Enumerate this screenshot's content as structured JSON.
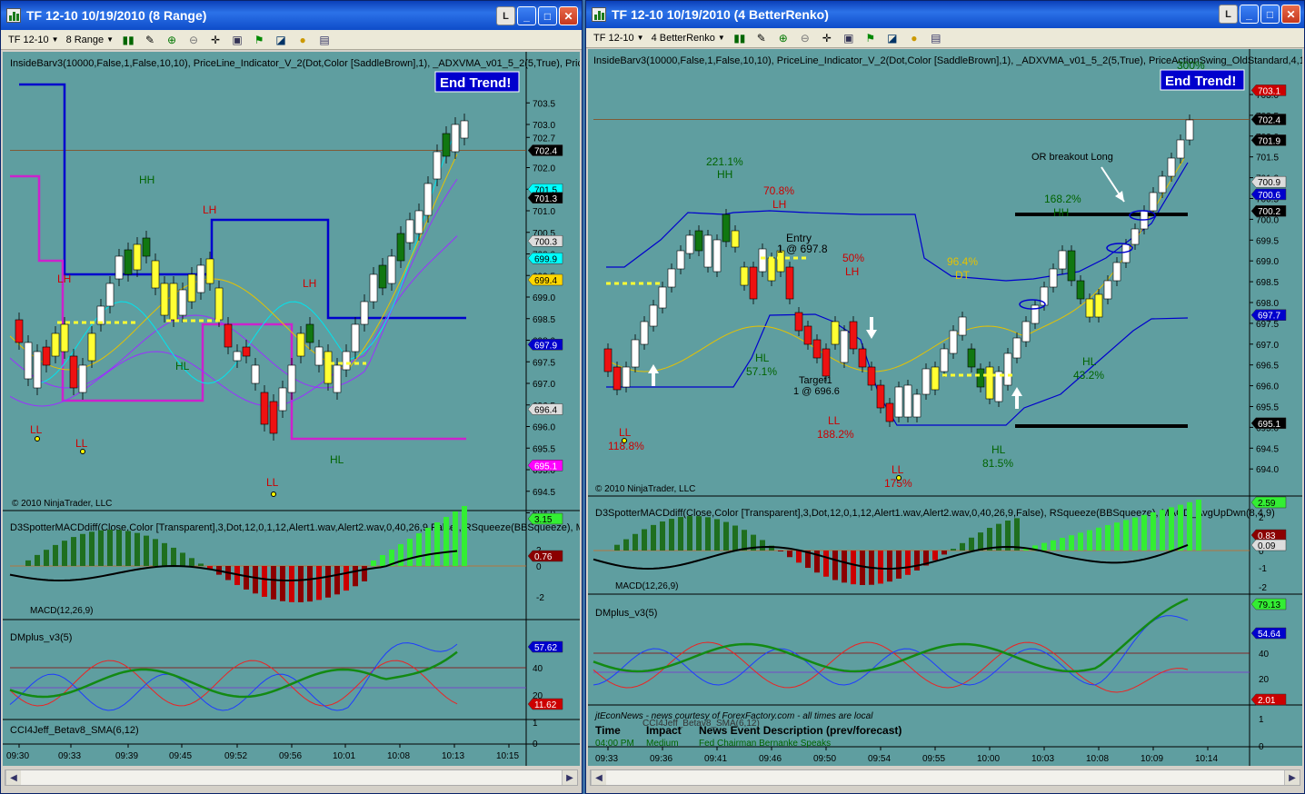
{
  "left_window": {
    "title": "TF 12-10  10/19/2010 (8 Range)",
    "btn_l": "L",
    "instrument": "TF 12-10",
    "period": "8 Range",
    "indicator_line": "InsideBarv3(10000,False,1,False,10,10), PriceLine_Indicator_V_2(Dot,Color [SaddleBrown],1), _ADXVMA_v01_5_2(5,True), Pric",
    "end_trend": "End Trend!",
    "copyright": "© 2010 NinjaTrader, LLC",
    "price_ticks": [
      "703.5",
      "703.0",
      "702.7",
      "702.0",
      "701.5",
      "701.0",
      "700.5",
      "700.0",
      "699.5",
      "699.0",
      "698.5",
      "698.0",
      "697.5",
      "697.0",
      "696.5",
      "696.0",
      "695.5",
      "695.0",
      "694.5",
      "694.0"
    ],
    "price_tags": [
      {
        "v": "702.4",
        "c": "#000000",
        "t": "#ffffff"
      },
      {
        "v": "701.5",
        "c": "#00ffff",
        "t": "#000000"
      },
      {
        "v": "701.3",
        "c": "#000000",
        "t": "#ffffff"
      },
      {
        "v": "700.3",
        "c": "#dddddd",
        "t": "#000000"
      },
      {
        "v": "699.9",
        "c": "#00ffff",
        "t": "#000000"
      },
      {
        "v": "699.4",
        "c": "#ffd700",
        "t": "#000000"
      },
      {
        "v": "697.9",
        "c": "#0000cd",
        "t": "#ffffff"
      },
      {
        "v": "696.4",
        "c": "#dddddd",
        "t": "#000000"
      },
      {
        "v": "695.1",
        "c": "#ff00ff",
        "t": "#ffffff"
      }
    ],
    "labels": {
      "hh": "HH",
      "lh1": "LH",
      "lh2": "LH",
      "lh3": "LH",
      "hl1": "HL",
      "hl2": "HL",
      "ll1": "LL",
      "ll2": "LL",
      "ll3": "LL"
    },
    "macd_panel": "D3SpotterMACDdiff(Close,Color [Transparent],3,Dot,12,0,1,12,Alert1.wav,Alert2.wav,0,40,26,9,False), RSqueeze(BBSqueeze), M",
    "macd_label": "MACD(12,26,9)",
    "macd_ticks": [
      "2",
      "0",
      "-2"
    ],
    "macd_tags": [
      "3.15",
      "0.76"
    ],
    "dm_panel": "DMplus_v3(5)",
    "dm_ticks": [
      "40",
      "20"
    ],
    "dm_tags": [
      "57.62",
      "11.62"
    ],
    "cci_panel": "CCI4Jeff_Betav8_SMA(6,12)",
    "cci_ticks": [
      "1",
      "0"
    ],
    "time_ticks": [
      "09:30",
      "09:33",
      "09:39",
      "09:45",
      "09:52",
      "09:56",
      "10:01",
      "10:08",
      "10:13",
      "10:15"
    ]
  },
  "right_window": {
    "title": "TF 12-10  10/19/2010 (4 BetterRenko)",
    "btn_l": "L",
    "instrument": "TF 12-10",
    "period": "4 BetterRenko",
    "indicator_line": "InsideBarv3(10000,False,1,False,10,10), PriceLine_Indicator_V_2(Dot,Color [SaddleBrown],1), _ADXVMA_v01_5_2(5,True), PriceActionSwing_OldStandard,4,1",
    "end_trend": "End Trend!",
    "copyright": "© 2010 NinjaTrader, LLC",
    "price_ticks": [
      "703.0",
      "702.5",
      "702.0",
      "701.5",
      "701.0",
      "700.5",
      "700.0",
      "699.5",
      "699.0",
      "698.5",
      "698.0",
      "697.5",
      "697.0",
      "696.5",
      "696.0",
      "695.5",
      "695.0",
      "694.5",
      "694.0"
    ],
    "price_tags": [
      {
        "v": "703.1",
        "c": "#cc0000",
        "t": "#ffffff"
      },
      {
        "v": "702.4",
        "c": "#000000",
        "t": "#ffffff"
      },
      {
        "v": "701.9",
        "c": "#000000",
        "t": "#ffffff"
      },
      {
        "v": "700.9",
        "c": "#dddddd",
        "t": "#000000"
      },
      {
        "v": "700.6",
        "c": "#0000cd",
        "t": "#ffffff"
      },
      {
        "v": "700.2",
        "c": "#000000",
        "t": "#ffffff"
      },
      {
        "v": "697.7",
        "c": "#0000cd",
        "t": "#ffffff"
      },
      {
        "v": "695.1",
        "c": "#000000",
        "t": "#ffffff"
      }
    ],
    "annotations": {
      "hh_pct": "221.1%",
      "hh": "HH",
      "lh_pct": "70.8%",
      "lh": "LH",
      "entry": "Entry",
      "entry_detail": "1 @ 697.8",
      "lh2_pct": "50%",
      "lh2": "LH",
      "dt_pct": "96.4%",
      "dt": "DT",
      "or_breakout": "OR breakout Long",
      "hh2_pct": "168.2%",
      "hh2": "HH",
      "top_pct": "300%",
      "hl1": "HL",
      "hl1_pct": "57.1%",
      "target": "Target1",
      "target_detail": "1 @ 696.6",
      "ll1": "LL",
      "ll1_pct": "118.8%",
      "ll2": "LL",
      "ll2_pct": "188.2%",
      "ll3": "LL",
      "ll3_pct": "175%",
      "hl2": "HL",
      "hl2_pct": "81.5%",
      "hl3": "HL",
      "hl3_pct": "43.2%"
    },
    "macd_panel": "D3SpotterMACDdiff(Close,Color [Transparent],3,Dot,12,0,1,12,Alert1.wav,Alert2.wav,0,40,26,9,False), RSqueeze(BBSqueeze), MACD_AvgUpDwn(8,4,9)",
    "macd_label": "MACD(12,26,9)",
    "macd_ticks": [
      "2",
      "1",
      "0",
      "-1",
      "-2"
    ],
    "macd_tags": [
      "2.59",
      "0.83",
      "0.09"
    ],
    "dm_panel": "DMplus_v3(5)",
    "dm_ticks": [
      "40",
      "20"
    ],
    "dm_tags": [
      "79.13",
      "54.64",
      "2.01"
    ],
    "news_source": "jtEconNews - news courtesy of ForexFactory.com - all times are local",
    "cci_panel": "CCI4Jeff_Betav8_SMA(6,12)",
    "news_headers": {
      "time": "Time",
      "impact": "Impact",
      "desc": "News Event Description (prev/forecast)"
    },
    "news_row": {
      "time": "04:00 PM",
      "impact": "Medium",
      "desc": "Fed Chairman Bernanke Speaks"
    },
    "cci_ticks": [
      "1",
      "0"
    ],
    "time_ticks": [
      "09:33",
      "09:36",
      "09:41",
      "09:46",
      "09:50",
      "09:54",
      "09:55",
      "10:00",
      "10:03",
      "10:08",
      "10:09",
      "10:14"
    ]
  }
}
